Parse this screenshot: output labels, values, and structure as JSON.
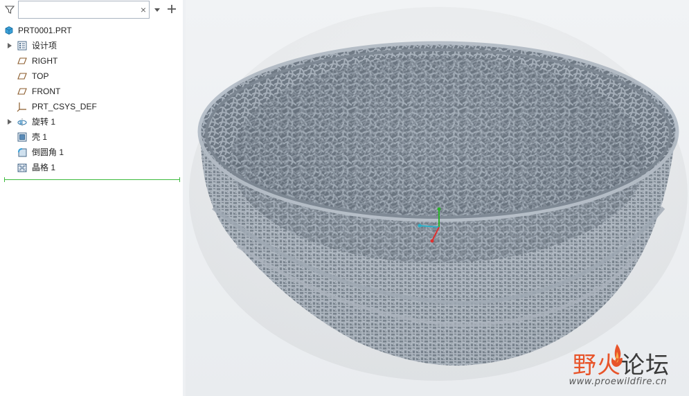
{
  "filter": {
    "value": "",
    "clear_glyph": "×",
    "icons": {
      "filter": "funnel-icon",
      "clear": "close-icon",
      "dropdown": "chevron-down-icon",
      "add": "plus-icon"
    }
  },
  "tree": {
    "root": {
      "label": "PRT0001.PRT",
      "icon": "part-icon"
    },
    "items": [
      {
        "label": "设计项",
        "icon": "design-items-icon",
        "expandable": true
      },
      {
        "label": "RIGHT",
        "icon": "datum-plane-icon",
        "expandable": false
      },
      {
        "label": "TOP",
        "icon": "datum-plane-icon",
        "expandable": false
      },
      {
        "label": "FRONT",
        "icon": "datum-plane-icon",
        "expandable": false
      },
      {
        "label": "PRT_CSYS_DEF",
        "icon": "coordinate-system-icon",
        "expandable": false
      },
      {
        "label": "旋转 1",
        "icon": "revolve-icon",
        "expandable": true
      },
      {
        "label": "壳 1",
        "icon": "shell-icon",
        "expandable": false
      },
      {
        "label": "倒圆角 1",
        "icon": "round-icon",
        "expandable": false
      },
      {
        "label": "晶格 1",
        "icon": "lattice-icon",
        "expandable": false
      }
    ]
  },
  "viewport": {
    "model": "lattice-bowl",
    "model_color": "#8b96a3",
    "background": "#eceff2",
    "triad_colors": {
      "x": "#e03030",
      "y": "#2ab02a",
      "z": "#2ab0c8"
    }
  },
  "watermark": {
    "title_red": "野火",
    "title_dark": "论坛",
    "url": "www.proewildfire.cn"
  }
}
